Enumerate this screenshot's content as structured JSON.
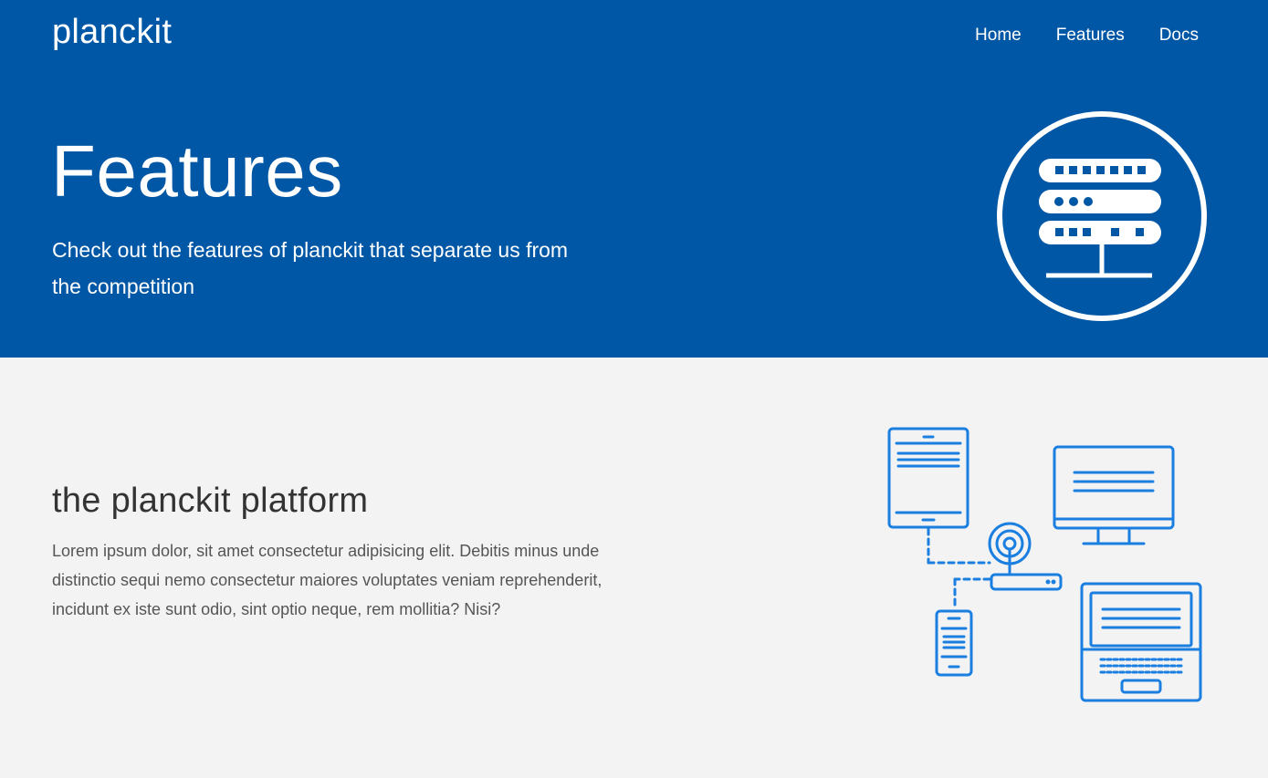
{
  "brand": "planckit",
  "nav": [
    "Home",
    "Features",
    "Docs"
  ],
  "hero": {
    "title": "Features",
    "subtitle": "Check out the features of planckit that separate us from the competition",
    "icon": "server-rack-icon"
  },
  "section": {
    "title": "the planckit platform",
    "text": "Lorem ipsum dolor, sit amet consectetur adipisicing elit. Debitis minus unde distinctio sequi nemo consectetur maiores voluptates veniam reprehenderit, incidunt ex iste sunt odio, sint optio neque, rem mollitia? Nisi?",
    "illustration": "connected-devices-icon"
  },
  "colors": {
    "hero_background": "#0057a5",
    "page_background": "#f3f3f3",
    "accent": "#1a7fe0"
  }
}
